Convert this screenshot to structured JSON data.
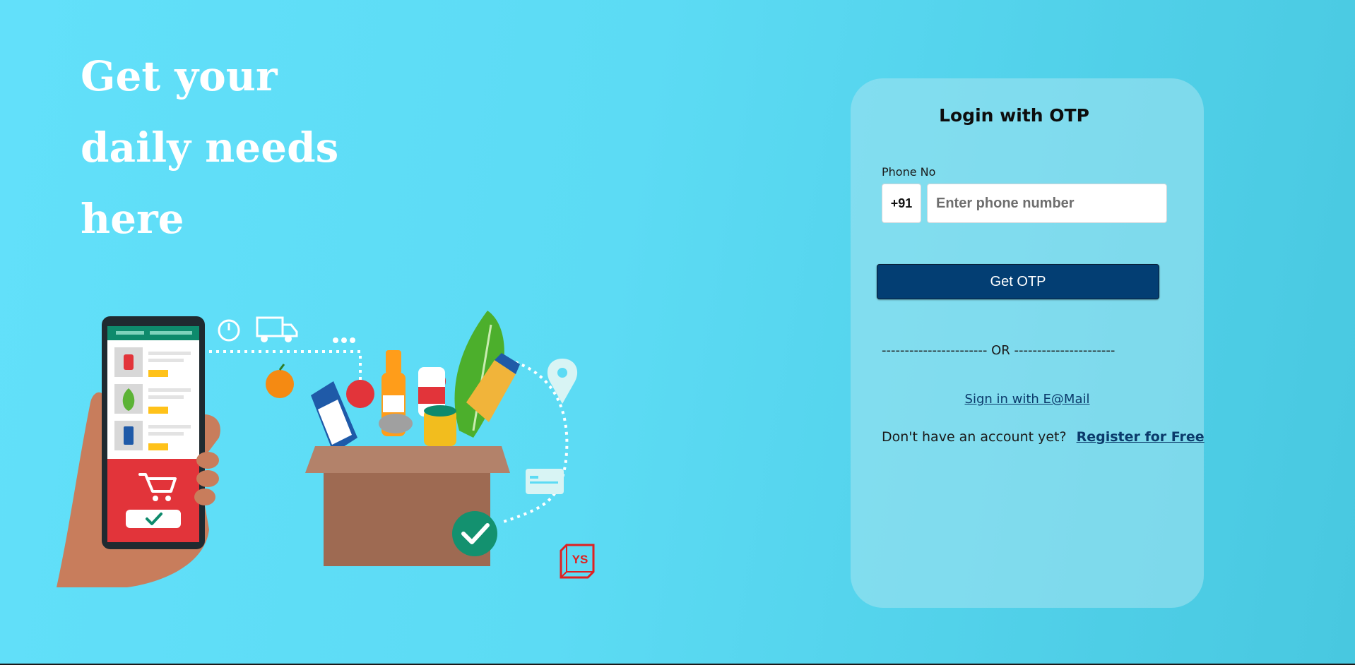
{
  "hero": {
    "title": "Get your daily needs here"
  },
  "illustration": {
    "brand_badge": "YS",
    "colors": {
      "phone_accent": "#e2343a",
      "header_green": "#0e8a6c",
      "box_brown": "#9e6a52",
      "check_green": "#13916f"
    }
  },
  "login": {
    "title": "Login with OTP",
    "phone_label": "Phone No",
    "country_code": "+91",
    "phone_placeholder": "Enter phone number",
    "phone_value": "",
    "otp_button": "Get OTP",
    "or_divider": "----------------------- OR ----------------------",
    "email_link": "Sign in with E@Mail",
    "no_account_text": "Don't have an account yet?",
    "register_link": "Register for Free"
  },
  "colors": {
    "background": "#5cdbf4",
    "card": "#a5e4f0",
    "button": "#033e73",
    "link": "#0b3a6b"
  }
}
